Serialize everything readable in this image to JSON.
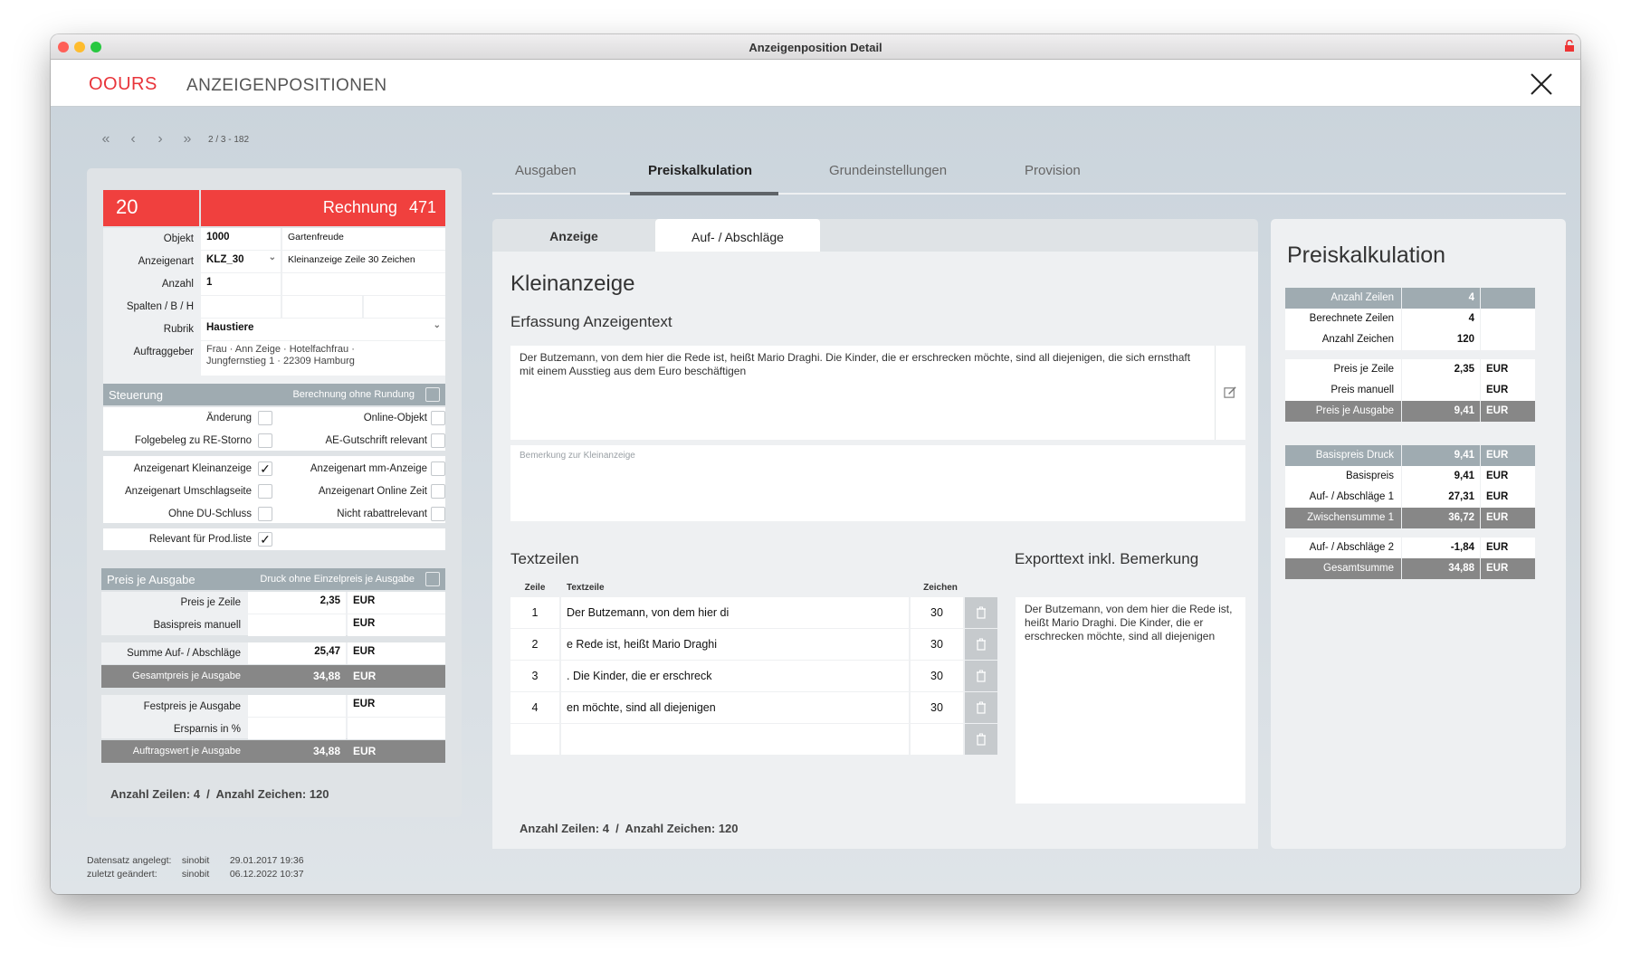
{
  "window": {
    "title": "Anzeigenposition Detail"
  },
  "header": {
    "logo": "OOURS",
    "module": "ANZEIGENPOSITIONEN"
  },
  "nav": {
    "counter": "2 / 3 - 182"
  },
  "left": {
    "number": "20",
    "doc_type": "Rechnung",
    "doc_number": "471",
    "objekt": {
      "label": "Objekt",
      "code": "1000",
      "name": "Gartenfreude"
    },
    "anzeigenart": {
      "label": "Anzeigenart",
      "code": "KLZ_30",
      "name": "Kleinanzeige Zeile 30 Zeichen"
    },
    "anzahl": {
      "label": "Anzahl",
      "value": "1"
    },
    "spalten": {
      "label": "Spalten / B / H"
    },
    "rubrik": {
      "label": "Rubrik",
      "value": "Haustiere"
    },
    "auftraggeber": {
      "label": "Auftraggeber",
      "line1": "Frau · Ann Zeige · Hotelfachfrau ·",
      "line2": "Jungfernstieg 1 · 22309 Hamburg"
    },
    "steuerung": {
      "title": "Steuerung",
      "rundung_label": "Berechnung ohne Rundung",
      "aenderung": "Änderung",
      "online_objekt": "Online-Objekt",
      "folgebeleg": "Folgebeleg zu RE-Storno",
      "ae_gutschrift": "AE-Gutschrift relevant",
      "klein": "Anzeigenart Kleinanzeige",
      "mm": "Anzeigenart mm-Anzeige",
      "umschlag": "Anzeigenart Umschlagseite",
      "online_zeit": "Anzeigenart Online Zeit",
      "du_schluss": "Ohne DU-Schluss",
      "rabatt": "Nicht rabattrelevant",
      "prodliste": "Relevant für Prod.liste"
    },
    "preis": {
      "title": "Preis je Ausgabe",
      "druck_label": "Druck ohne Einzelpreis je Ausgabe",
      "zeile_label": "Preis je Zeile",
      "zeile_value": "2,35",
      "basis_manuell_label": "Basispreis manuell",
      "summe_label": "Summe Auf- / Abschläge",
      "summe_value": "25,47",
      "gesamt_label": "Gesamtpreis je Ausgabe",
      "gesamt_value": "34,88",
      "fest_label": "Festpreis je Ausgabe",
      "ersparnis_label": "Ersparnis in %",
      "auftragswert_label": "Auftragswert je Ausgabe",
      "auftragswert_value": "34,88",
      "currency": "EUR"
    },
    "summary": "Anzahl Zeilen: 4  /  Anzahl Zeichen: 120"
  },
  "meta": {
    "created_label": "Datensatz angelegt:",
    "created_user": "sinobit",
    "created_date": "29.01.2017 19:36",
    "changed_label": "zuletzt geändert:",
    "changed_user": "sinobit",
    "changed_date": "06.12.2022 10:37"
  },
  "tabs": [
    "Ausgaben",
    "Preiskalkulation",
    "Grundeinstellungen",
    "Provision"
  ],
  "subtabs": [
    "Anzeige",
    "Auf- / Abschläge"
  ],
  "middle": {
    "title": "Kleinanzeige",
    "erfassung_title": "Erfassung Anzeigentext",
    "text": "Der Butzemann, von dem hier die Rede ist, heißt Mario Draghi. Die Kinder, die er erschrecken möchte, sind all diejenigen, die sich ernsthaft mit einem Ausstieg aus dem Euro beschäftigen",
    "bemerkung_placeholder": "Bemerkung zur Kleinanzeige",
    "textzeilen_title": "Textzeilen",
    "col_zeile": "Zeile",
    "col_text": "Textzeile",
    "col_zeichen": "Zeichen",
    "rows": [
      {
        "nr": "1",
        "text": "Der Butzemann, von dem hier di",
        "zeichen": "30"
      },
      {
        "nr": "2",
        "text": "e Rede ist, heißt Mario Draghi",
        "zeichen": "30"
      },
      {
        "nr": "3",
        "text": ". Die Kinder, die er erschreck",
        "zeichen": "30"
      },
      {
        "nr": "4",
        "text": "en möchte, sind all diejenigen",
        "zeichen": "30"
      },
      {
        "nr": "",
        "text": "",
        "zeichen": ""
      }
    ],
    "export_title": "Exporttext inkl. Bemerkung",
    "export_text": "Der Butzemann, von dem hier die Rede ist, heißt Mario Draghi. Die Kinder, die er erschrecken möchte, sind all diejenigen",
    "summary": "Anzahl Zeilen: 4  /  Anzahl Zeichen: 120"
  },
  "right": {
    "title": "Preiskalkulation",
    "anzahl_zeilen": {
      "label": "Anzahl Zeilen",
      "value": "4"
    },
    "berechnete_zeilen": {
      "label": "Berechnete Zeilen",
      "value": "4"
    },
    "anzahl_zeichen": {
      "label": "Anzahl Zeichen",
      "value": "120"
    },
    "preis_zeile": {
      "label": "Preis je Zeile",
      "value": "2,35"
    },
    "preis_manuell": {
      "label": "Preis manuell",
      "value": ""
    },
    "preis_ausgabe": {
      "label": "Preis je Ausgabe",
      "value": "9,41"
    },
    "basispreis_druck": {
      "label": "Basispreis Druck",
      "value": "9,41"
    },
    "basispreis": {
      "label": "Basispreis",
      "value": "9,41"
    },
    "auf_ab_1": {
      "label": "Auf- / Abschläge 1",
      "value": "27,31"
    },
    "zwischensumme": {
      "label": "Zwischensumme 1",
      "value": "36,72"
    },
    "auf_ab_2": {
      "label": "Auf- / Abschläge 2",
      "value": "-1,84"
    },
    "gesamtsumme": {
      "label": "Gesamtsumme",
      "value": "34,88"
    },
    "currency": "EUR"
  }
}
